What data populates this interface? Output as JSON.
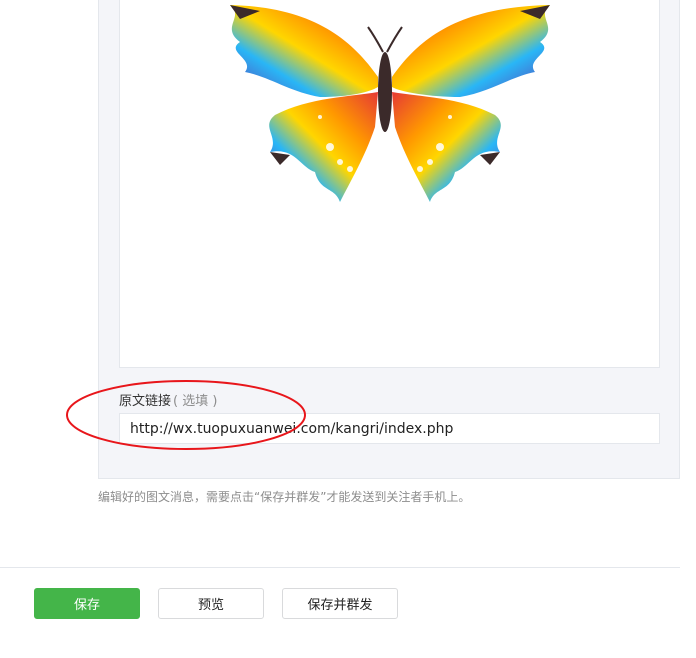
{
  "editor": {
    "cover_image": "butterfly-illustration",
    "source_link": {
      "label": "原文链接",
      "optional_hint": "( 选填 )",
      "value": "http://wx.tuopuxuanwei.com/kangri/index.php"
    },
    "hint_text": "编辑好的图文消息，需要点击“保存并群发”才能发送到关注者手机上。"
  },
  "annotation": {
    "color": "#e8161b"
  },
  "actions": {
    "save_label": "保存",
    "preview_label": "预览",
    "save_send_label": "保存并群发"
  },
  "colors": {
    "primary": "#44b549",
    "panel_bg": "#f4f5f9"
  }
}
